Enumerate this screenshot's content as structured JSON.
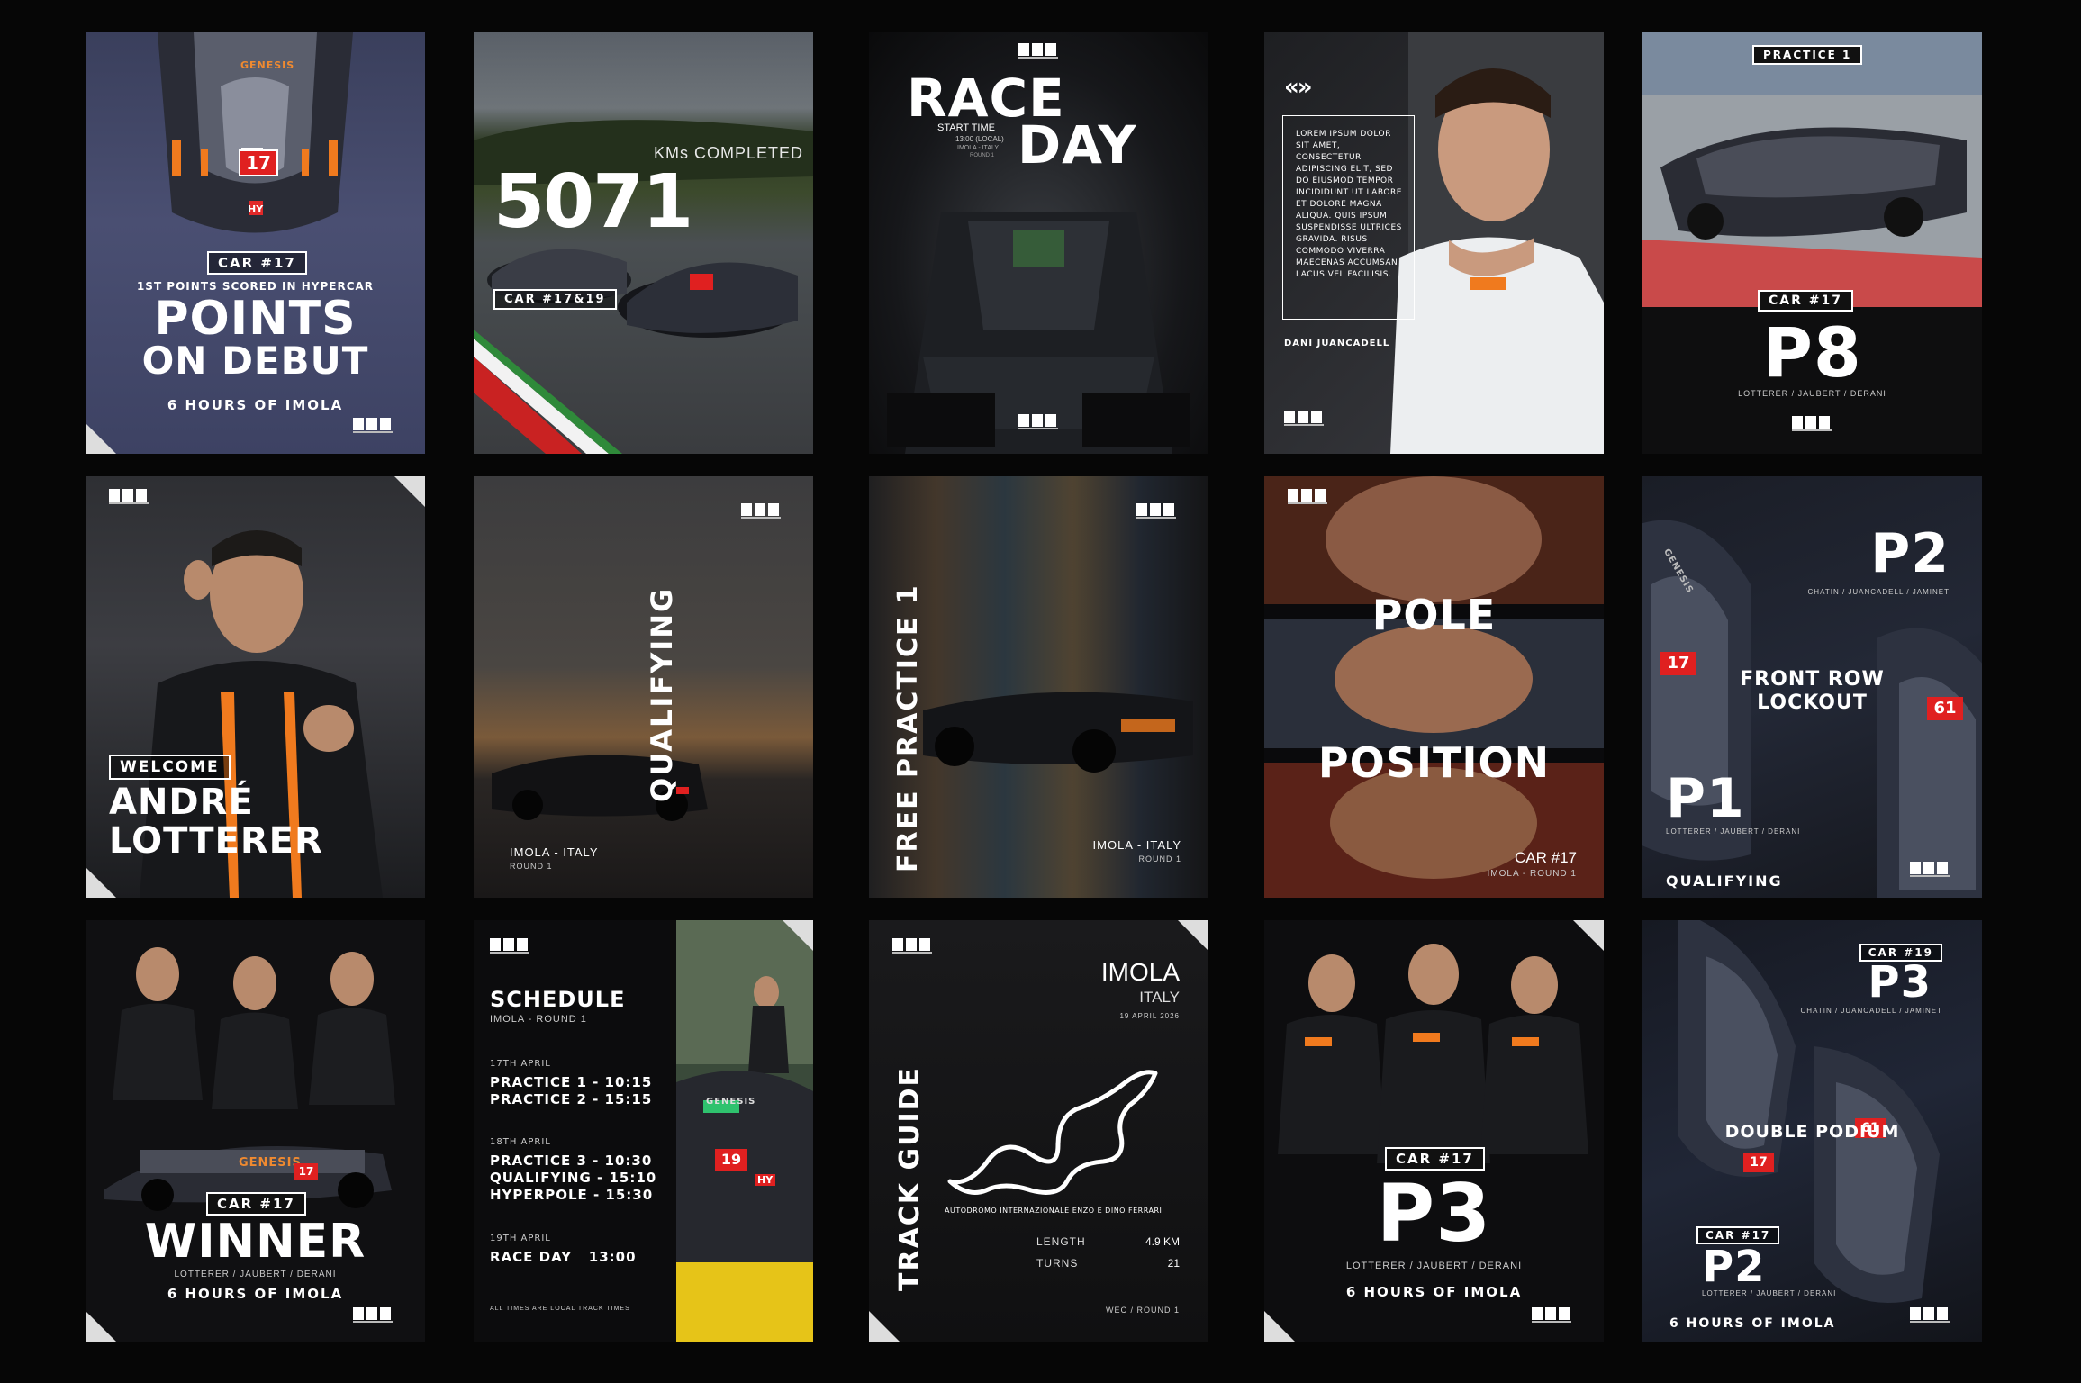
{
  "card1": {
    "car": "CAR #17",
    "subtitle": "1ST POINTS SCORED IN HYPERCAR",
    "title1": "POINTS",
    "title2": "ON DEBUT",
    "event": "6 HOURS OF IMOLA",
    "car_number": "17",
    "hood": "GENESIS",
    "hy": "HY"
  },
  "card2": {
    "label": "KMs COMPLETED",
    "value": "5071",
    "car": "CAR #17&19"
  },
  "card3": {
    "title1": "RACE",
    "title2": "DAY",
    "start_label": "START TIME",
    "start_time": "13:00 (LOCAL)",
    "loc": "IMOLA - ITALY",
    "round": "ROUND 1"
  },
  "card4": {
    "arrows": "«»",
    "body": "LOREM IPSUM DOLOR SIT AMET, CONSECTETUR ADIPISCING ELIT, SED DO EIUSMOD TEMPOR INCIDIDUNT UT LABORE ET DOLORE MAGNA ALIQUA. QUIS IPSUM SUSPENDISSE ULTRICES GRAVIDA. RISUS COMMODO VIVERRA MAECENAS ACCUMSAN LACUS VEL FACILISIS.",
    "name": "DANI JUANCADELL"
  },
  "card5": {
    "session": "PRACTICE 1",
    "car": "CAR #17",
    "pos": "P8",
    "drivers": "LOTTERER / JAUBERT / DERANI"
  },
  "card6": {
    "tag": "WELCOME",
    "name1": "ANDRÉ",
    "name2": "LOTTERER"
  },
  "card7": {
    "title": "QUALIFYING",
    "loc": "IMOLA - ITALY",
    "round": "ROUND 1"
  },
  "card8": {
    "title": "FREE PRACTICE 1",
    "loc": "IMOLA - ITALY",
    "round": "ROUND 1"
  },
  "card9": {
    "title1": "POLE",
    "title2": "POSITION",
    "car": "CAR #17",
    "loc": "IMOLA - ROUND 1"
  },
  "card10": {
    "pos_top": "P2",
    "drivers_top": "CHATIN / JUANCADELL / JAMINET",
    "headline1": "FRONT ROW",
    "headline2": "LOCKOUT",
    "pos_bottom": "P1",
    "drivers_bottom": "LOTTERER / JAUBERT / DERANI",
    "session": "QUALIFYING",
    "num_a": "17",
    "num_b": "61",
    "hood": "GENESIS"
  },
  "card11": {
    "car": "CAR #17",
    "title": "WINNER",
    "drivers": "LOTTERER / JAUBERT / DERANI",
    "event": "6 HOURS OF IMOLA",
    "car_number": "17",
    "hood": "GENESIS"
  },
  "card12": {
    "title": "SCHEDULE",
    "subtitle": "IMOLA - ROUND 1",
    "days": [
      {
        "date": "17TH APRIL",
        "lines": [
          "PRACTICE 1 - 10:15",
          "PRACTICE 2 - 15:15"
        ]
      },
      {
        "date": "18TH APRIL",
        "lines": [
          "PRACTICE 3 - 10:30",
          "QUALIFYING - 15:10",
          "HYPERPOLE - 15:30"
        ]
      },
      {
        "date": "19TH APRIL",
        "lines": [
          "RACE DAY   13:00"
        ]
      }
    ],
    "footer": "ALL TIMES ARE LOCAL TRACK TIMES",
    "car_number": "19",
    "hood": "GENESIS",
    "hy": "HY"
  },
  "card13": {
    "title": "TRACK GUIDE",
    "city": "IMOLA",
    "country": "ITALY",
    "date": "19 APRIL 2026",
    "circuit": "AUTODROMO INTERNAZIONALE ENZO E DINO FERRARI",
    "length_label": "LENGTH",
    "length_value": "4.9 KM",
    "turns_label": "TURNS",
    "turns_value": "21",
    "footer": "WEC / ROUND 1"
  },
  "card14": {
    "car": "CAR #17",
    "pos": "P3",
    "drivers": "LOTTERER / JAUBERT / DERANI",
    "event": "6 HOURS OF IMOLA"
  },
  "card15": {
    "car_top": "CAR #19",
    "pos_top": "P3",
    "drivers_top": "CHATIN / JUANCADELL / JAMINET",
    "headline": "DOUBLE PODIUM",
    "car_bottom": "CAR #17",
    "pos_bottom": "P2",
    "drivers_bottom": "LOTTERER / JAUBERT / DERANI",
    "event": "6 HOURS OF IMOLA",
    "num_a": "17",
    "num_b": "61"
  }
}
